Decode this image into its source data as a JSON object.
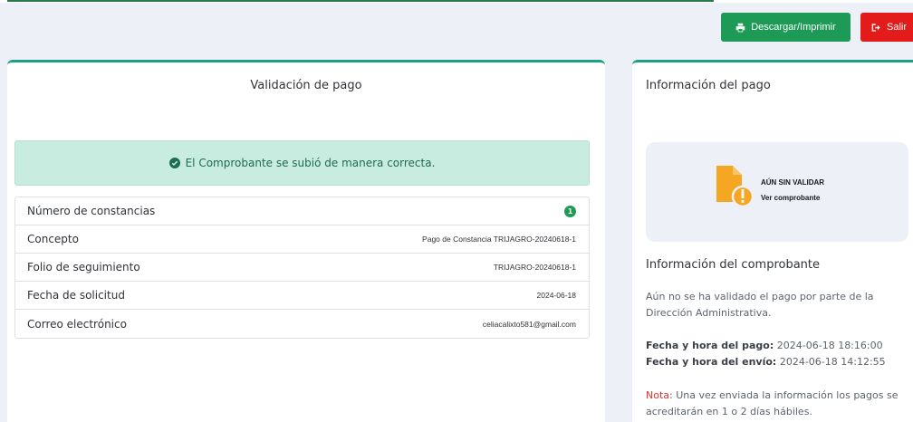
{
  "toolbar": {
    "print_label": "Descargar/Imprimir",
    "exit_label": "Salir"
  },
  "validation": {
    "title": "Validación de pago",
    "alert": "El Comprobante se subió de manera correcta.",
    "rows": [
      {
        "label": "Número de constancias",
        "value": "1"
      },
      {
        "label": "Concepto",
        "value": "Pago de Constancia TRIJAGRO-20240618-1"
      },
      {
        "label": "Folio de seguimiento",
        "value": "TRIJAGRO-20240618-1"
      },
      {
        "label": "Fecha de solicitud",
        "value": "2024-06-18"
      },
      {
        "label": "Correo electrónico",
        "value": "celiacalixto581@gmail.com"
      }
    ]
  },
  "payment_info": {
    "title": "Información del pago",
    "status": "AÚN SIN VALIDAR",
    "view_link": "Ver comprobante"
  },
  "receipt_info": {
    "title": "Información del comprobante",
    "message": "Aún no se ha validado el pago por parte de la Dirección Administrativa.",
    "payment_datetime_label": "Fecha y hora del pago:",
    "payment_datetime": "2024-06-18 18:16:00",
    "sent_datetime_label": "Fecha y hora del envío:",
    "sent_datetime": "2024-06-18 14:12:55",
    "note_label": "Nota:",
    "note_text": "Una vez enviada la información los pagos se acreditarán en 1 o 2 días hábiles."
  },
  "colors": {
    "accent": "#1aa08a",
    "print_button": "#1d9b56",
    "exit_button": "#e41b1b",
    "alert_bg": "#c9ece0",
    "icon_orange": "#f5a623"
  },
  "icons": {
    "print": "print-icon",
    "exit": "sign-out-icon",
    "check": "check-circle-icon",
    "document": "file-warning-icon"
  }
}
